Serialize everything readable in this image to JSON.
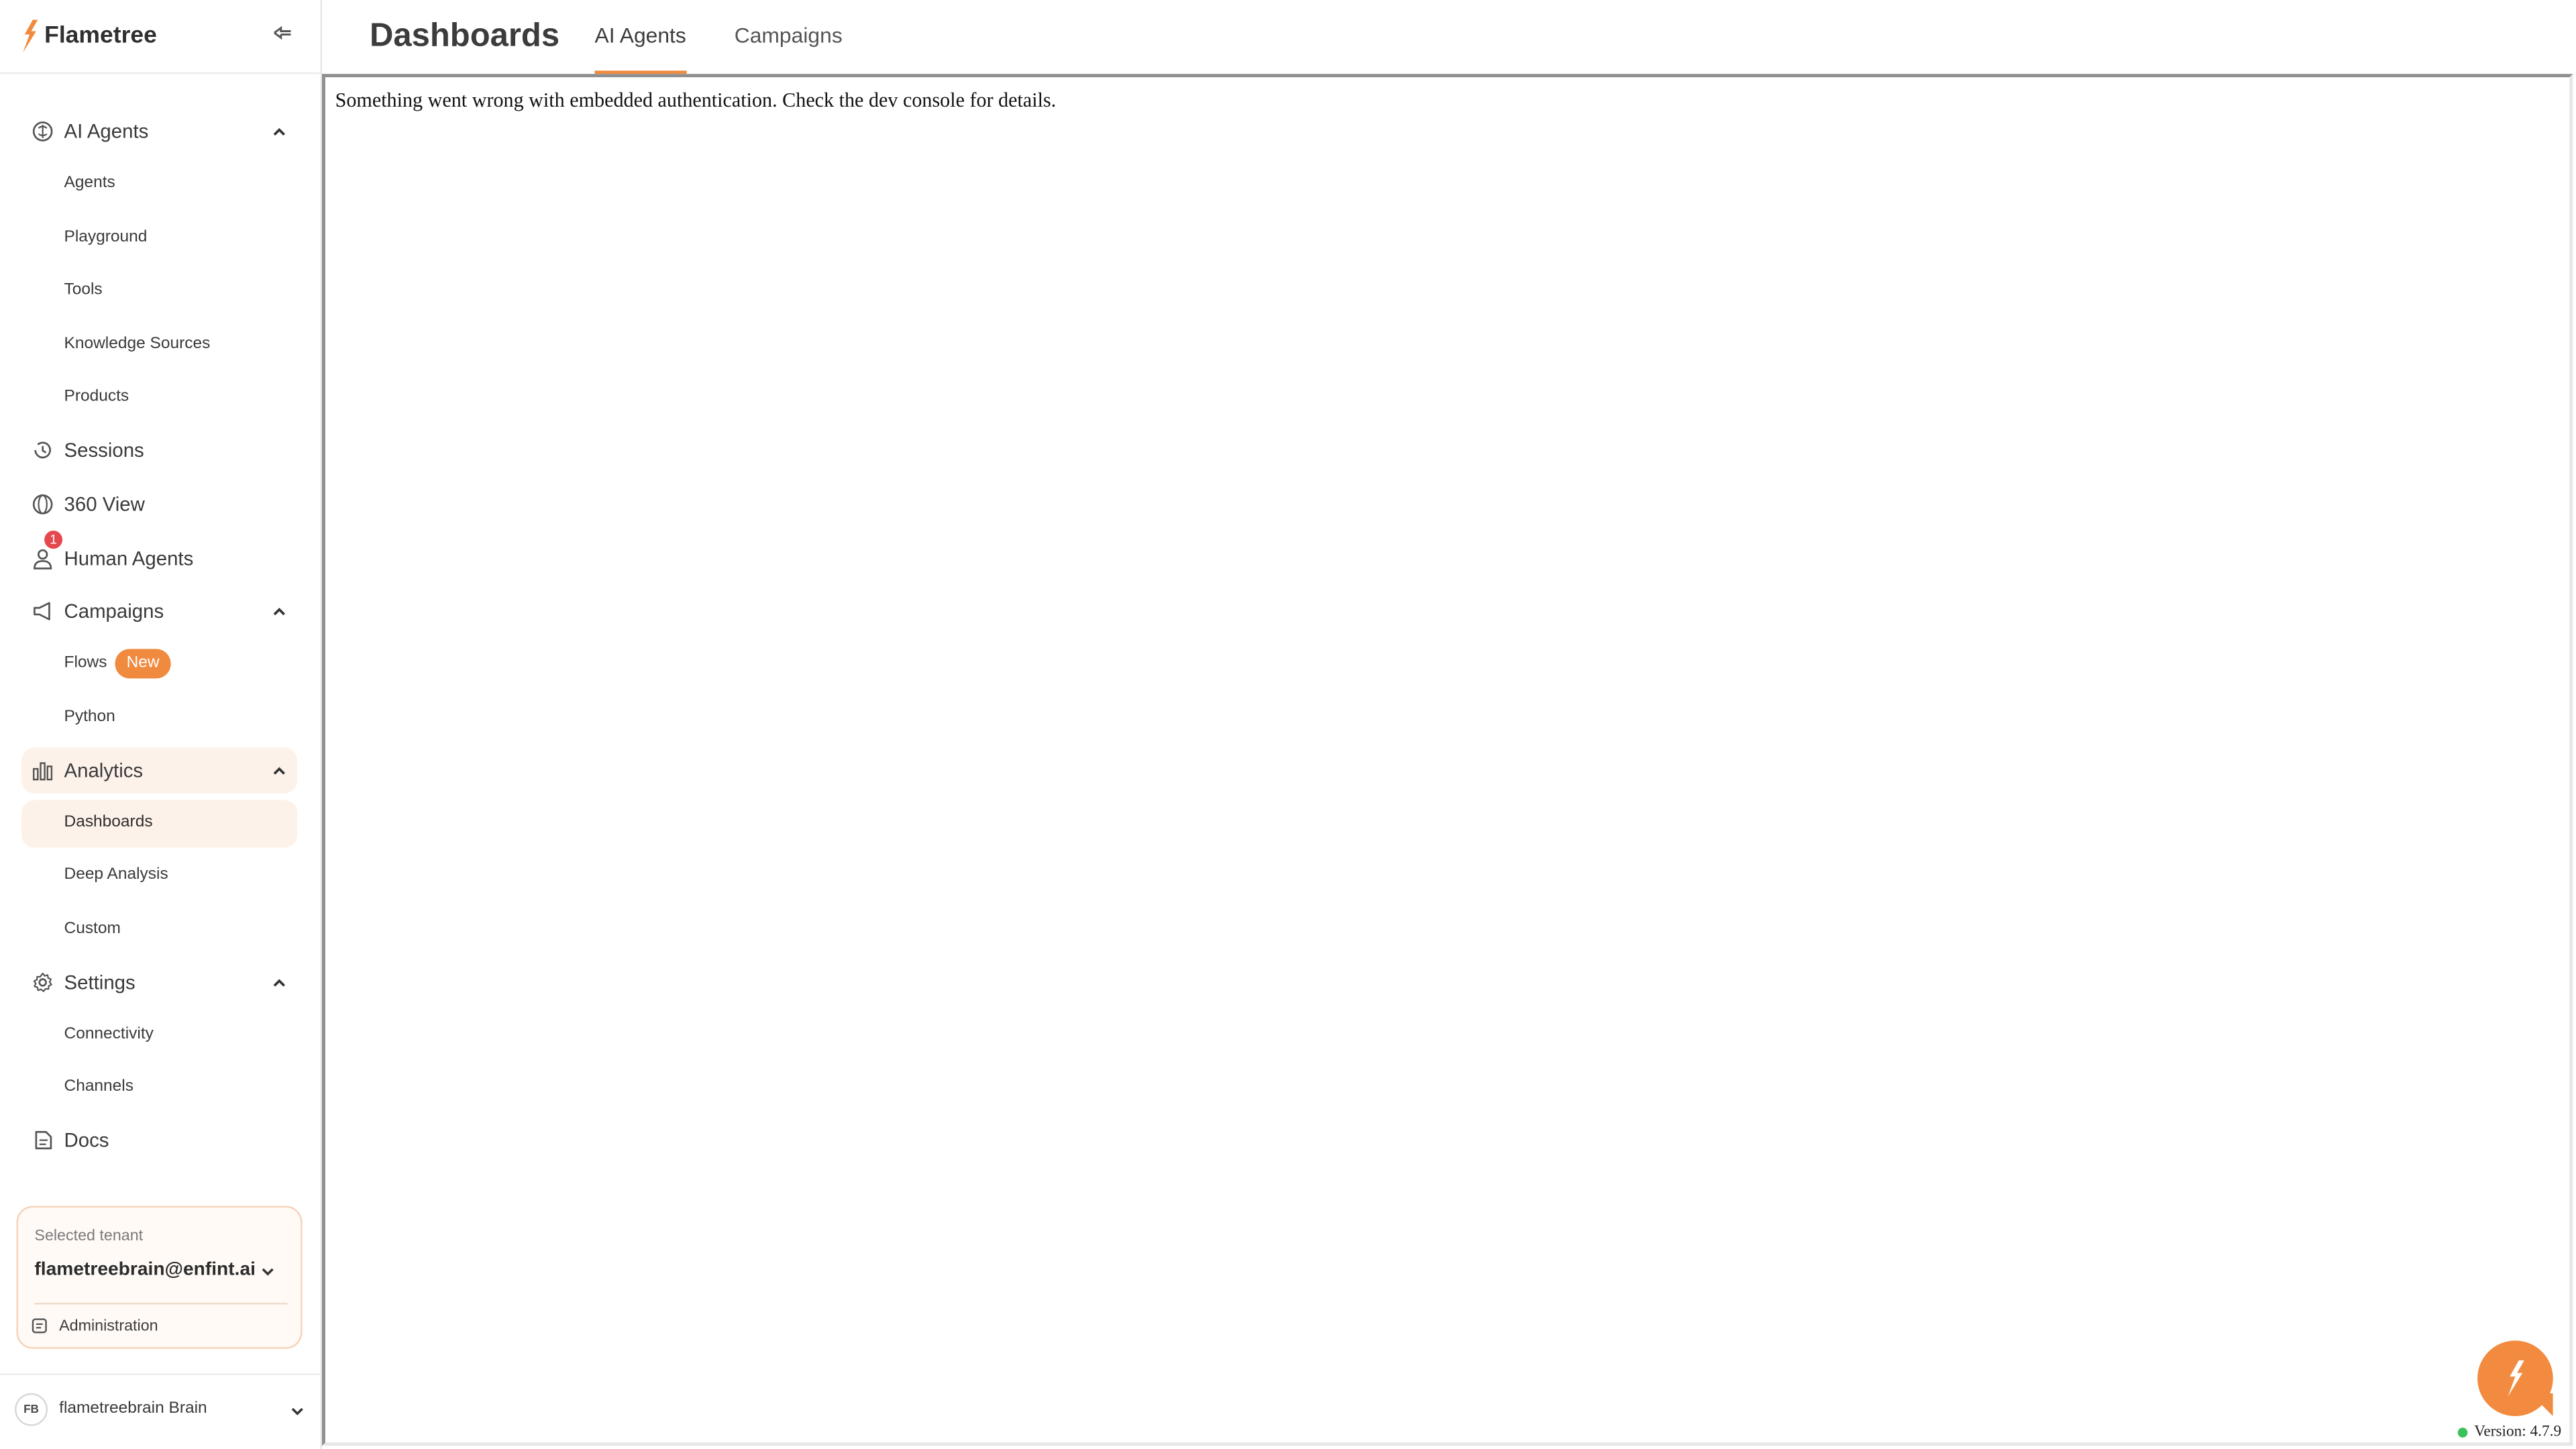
{
  "brand": {
    "name": "Flametree",
    "accent": "#f08a3e"
  },
  "sidebar": {
    "ai_agents": {
      "label": "AI Agents",
      "items": [
        "Agents",
        "Playground",
        "Tools",
        "Knowledge Sources",
        "Products"
      ]
    },
    "sessions": "Sessions",
    "view360": "360 View",
    "human_agents": {
      "label": "Human Agents",
      "notification_count": "1"
    },
    "campaigns": {
      "label": "Campaigns",
      "flows": "Flows",
      "flows_badge": "New",
      "python": "Python"
    },
    "analytics": {
      "label": "Analytics",
      "items": [
        "Dashboards",
        "Deep Analysis",
        "Custom"
      ]
    },
    "settings": {
      "label": "Settings",
      "items": [
        "Connectivity",
        "Channels"
      ]
    },
    "docs": "Docs"
  },
  "tenant": {
    "label": "Selected tenant",
    "value": "flametreebrain@enfint.ai",
    "admin": "Administration"
  },
  "user": {
    "initials": "FB",
    "name": "flametreebrain Brain"
  },
  "header": {
    "title": "Dashboards",
    "tabs": [
      "AI Agents",
      "Campaigns"
    ],
    "active_tab": "AI Agents"
  },
  "content": {
    "error": "Something went wrong with embedded authentication. Check the dev console for details."
  },
  "version": "Version: 4.7.9"
}
